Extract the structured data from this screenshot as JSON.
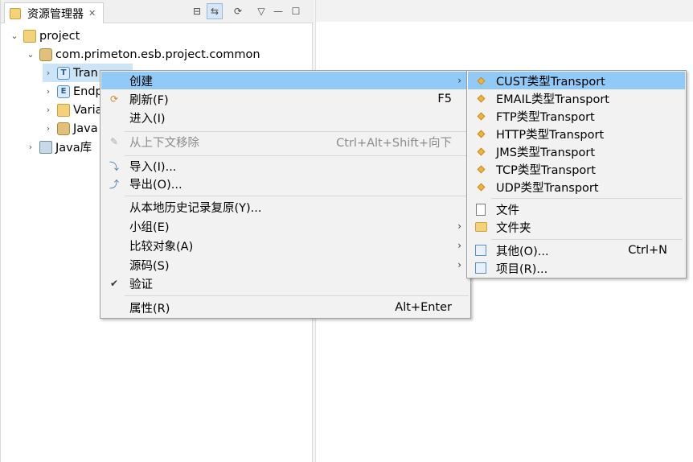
{
  "explorer": {
    "tab_title": "资源管理器",
    "tab_close": "✕",
    "tree": [
      {
        "label": "project",
        "twisty": "⌄"
      },
      {
        "label": "com.primeton.esb.project.common",
        "twisty": "⌄"
      },
      {
        "label": "Tran",
        "twisty": "›"
      },
      {
        "label": "Endp",
        "twisty": "›"
      },
      {
        "label": "Varia",
        "twisty": "›"
      },
      {
        "label": "Java",
        "twisty": "›"
      },
      {
        "label": "Java库",
        "twisty": "›"
      }
    ]
  },
  "toolbar": {
    "collapse_icon": "⊟",
    "link_icon": "⇆",
    "sync_icon": "⟳",
    "menu_icon": "▽",
    "minimize_icon": "—",
    "maximize_icon": "☐"
  },
  "context_menu": {
    "items": [
      {
        "label": "创建",
        "accel": "",
        "arrow": "›"
      },
      {
        "label": "刷新(F)",
        "accel": "F5",
        "arrow": ""
      },
      {
        "label": "进入(I)",
        "accel": "",
        "arrow": ""
      },
      {
        "label": "从上下文移除",
        "accel": "Ctrl+Alt+Shift+向下",
        "arrow": ""
      },
      {
        "label": "导入(I)...",
        "accel": "",
        "arrow": ""
      },
      {
        "label": "导出(O)...",
        "accel": "",
        "arrow": ""
      },
      {
        "label": "从本地历史记录复原(Y)...",
        "accel": "",
        "arrow": ""
      },
      {
        "label": "小组(E)",
        "accel": "",
        "arrow": "›"
      },
      {
        "label": "比较对象(A)",
        "accel": "",
        "arrow": "›"
      },
      {
        "label": "源码(S)",
        "accel": "",
        "arrow": "›"
      },
      {
        "label": "验证",
        "accel": "",
        "arrow": ""
      },
      {
        "label": "属性(R)",
        "accel": "Alt+Enter",
        "arrow": ""
      }
    ],
    "check_mark": "✔"
  },
  "submenu": {
    "items": [
      {
        "label": "CUST类型Transport",
        "accel": ""
      },
      {
        "label": "EMAIL类型Transport",
        "accel": ""
      },
      {
        "label": "FTP类型Transport",
        "accel": ""
      },
      {
        "label": "HTTP类型Transport",
        "accel": ""
      },
      {
        "label": "JMS类型Transport",
        "accel": ""
      },
      {
        "label": "TCP类型Transport",
        "accel": ""
      },
      {
        "label": "UDP类型Transport",
        "accel": ""
      },
      {
        "label": "文件",
        "accel": ""
      },
      {
        "label": "文件夹",
        "accel": ""
      },
      {
        "label": "其他(O)...",
        "accel": "Ctrl+N"
      },
      {
        "label": "项目(R)...",
        "accel": ""
      }
    ]
  },
  "colors": {
    "highlight": "#91c9f7",
    "menu_bg": "#f2f2f2",
    "selection": "#cce4f7"
  }
}
